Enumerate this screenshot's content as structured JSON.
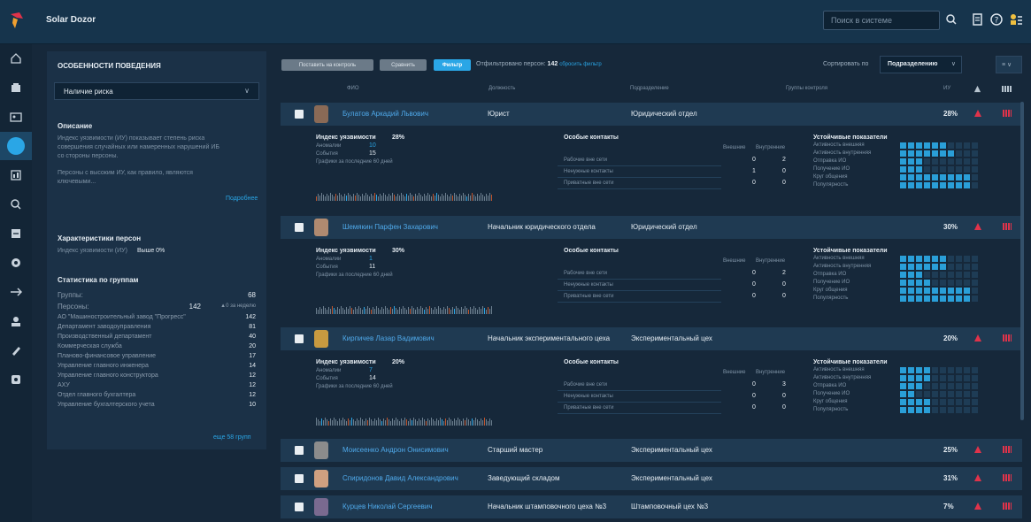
{
  "app": {
    "title": "Solar Dozor",
    "search_placeholder": "Поиск в системе"
  },
  "colors": {
    "accent": "#2aa6e6",
    "alert": "#e0334a",
    "bar_on": "#2a9fd8",
    "bar_off": "#1e3c55",
    "topbar": "#16344c"
  },
  "left_panel": {
    "title": "ОСОБЕННОСТИ ПОВЕДЕНИЯ",
    "select_value": "Наличие риска",
    "description_title": "Описание",
    "description_text_1": "Индекс уязвимости (ИУ) показывает степень риска",
    "description_text_2": "совершения случайных или намеренных нарушений ИБ",
    "description_text_3": "со стороны персоны.",
    "description_text_4": "Персоны с высоким ИУ, как правило, являются",
    "description_text_5": "ключевыми...",
    "more_link": "Подробнее",
    "person_chars_title": "Характеристики персон",
    "vuln_index_label": "Индекс уязвимости (ИУ)",
    "vuln_index_value": "Выше 0%",
    "groups_title": "Статистика по группам",
    "groups_label": "Группы:",
    "groups_value": "68",
    "persons_label": "Персоны:",
    "persons_value": "142",
    "persons_delta": "▲0 за неделю",
    "stats": [
      {
        "name": "АО \"Машиностроительный завод \"Прогресс\"",
        "value": "142"
      },
      {
        "name": "Департамент заводоуправления",
        "value": "81"
      },
      {
        "name": "Производственный департамент",
        "value": "40"
      },
      {
        "name": "Коммерческая служба",
        "value": "20"
      },
      {
        "name": "Планово-финансовое управление",
        "value": "17"
      },
      {
        "name": "Управление главного инженера",
        "value": "14"
      },
      {
        "name": "Управление главного конструктора",
        "value": "12"
      },
      {
        "name": "АХУ",
        "value": "12"
      },
      {
        "name": "Отдел главного бухгалтера",
        "value": "12"
      },
      {
        "name": "Управление бухгалтерского учета",
        "value": "10"
      }
    ],
    "more_groups": "еще 58 групп"
  },
  "toolbar": {
    "btn_control": "Поставить на контроль",
    "btn_compare": "Сравнить",
    "btn_filter": "Фильтр",
    "filtered_label": "Отфильтровано персон:",
    "filtered_value": "142",
    "reset_link": "сбросить фильтр",
    "sort_label": "Сортировать по",
    "sort_value": "Подразделению"
  },
  "table_headers": {
    "name": "ФИО",
    "position": "Должность",
    "dept": "Подразделение",
    "groups": "Группы контроля",
    "vi": "ИУ"
  },
  "detail_labels": {
    "vuln_index": "Индекс уязвимости",
    "anomalies": "Аномалии",
    "events": "События",
    "graph": "Графики за последние 60 дней",
    "special_contacts": "Особые контакты",
    "external": "Внешние",
    "internal": "Внутренние",
    "work_after_hours": "Рабочие вне сети",
    "unnecessary_contacts": "Ненужные контакты",
    "private_outside": "Приватные вне сети",
    "stable_indicators": "Устойчивые показатели",
    "ind_1": "Активность внешняя",
    "ind_2": "Активность внутренняя",
    "ind_3": "Отправка ИО",
    "ind_4": "Получение ИО",
    "ind_5": "Круг общения",
    "ind_6": "Популярность"
  },
  "rows": [
    {
      "name": "Булатов Аркадий Львович",
      "position": "Юрист",
      "dept": "Юридический отдел",
      "percent": "28%"
    },
    {
      "name": "Шемякин Парфен Захарович",
      "position": "Начальник юридического отдела",
      "dept": "Юридический отдел",
      "percent": "30%"
    },
    {
      "name": "Кирпичев Лазар Вадимович",
      "position": "Начальник экспериментального цеха",
      "dept": "Экспериментальный цех",
      "percent": "20%"
    },
    {
      "name": "Моисеенко Андрон Онисимович",
      "position": "Старший мастер",
      "dept": "Экспериментальный цех",
      "percent": "25%"
    },
    {
      "name": "Спиридонов Давид Александрович",
      "position": "Заведующий складом",
      "dept": "Экспериментальный цех",
      "percent": "31%"
    },
    {
      "name": "Курцев Николай Сергеевич",
      "position": "Начальник штамповочного цеха №3",
      "dept": "Штамповочный цех №3",
      "percent": "7%"
    }
  ],
  "details": [
    {
      "vi": "28%",
      "anomalies": "10",
      "events": "15",
      "work_ext": "0",
      "work_int": "2",
      "unn_ext": "1",
      "unn_int": "0",
      "priv_ext": "0",
      "priv_int": "0",
      "levels": [
        0.6,
        0.7,
        0.3,
        0.3,
        0.9,
        0.9
      ]
    },
    {
      "vi": "30%",
      "anomalies": "1",
      "events": "11",
      "work_ext": "0",
      "work_int": "2",
      "unn_ext": "0",
      "unn_int": "0",
      "priv_ext": "0",
      "priv_int": "0",
      "levels": [
        0.6,
        0.6,
        0.3,
        0.4,
        0.9,
        0.9
      ]
    },
    {
      "vi": "20%",
      "anomalies": "7",
      "events": "14",
      "work_ext": "0",
      "work_int": "3",
      "unn_ext": "0",
      "unn_int": "0",
      "priv_ext": "0",
      "priv_int": "0",
      "levels": [
        0.4,
        0.4,
        0.3,
        0.2,
        0.4,
        0.4
      ]
    }
  ]
}
